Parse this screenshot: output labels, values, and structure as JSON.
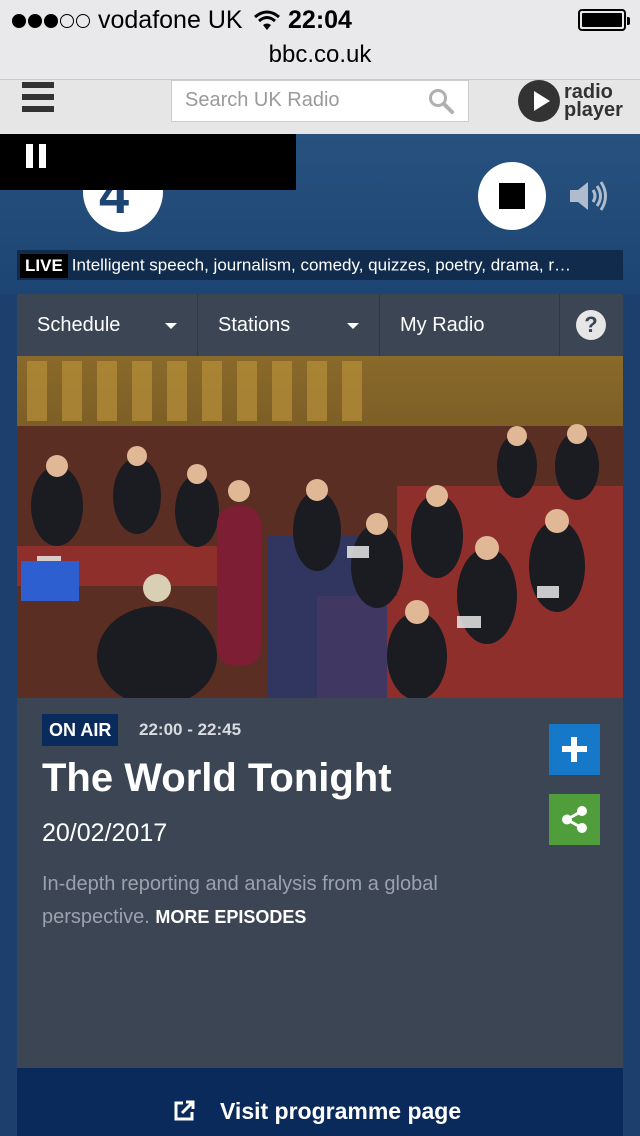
{
  "status_bar": {
    "carrier": "vodafone UK",
    "time": "22:04",
    "signal_bars_filled": 3,
    "signal_bars_total": 5
  },
  "url_bar": {
    "domain": "bbc.co.uk"
  },
  "header": {
    "search_placeholder": "Search UK Radio",
    "logo_line1": "radio",
    "logo_line2": "player"
  },
  "player": {
    "station_number": "4",
    "live_label": "LIVE",
    "live_description": "Intelligent speech, journalism, comedy, quizzes, poetry, drama, r…"
  },
  "nav": {
    "schedule": "Schedule",
    "stations": "Stations",
    "my_radio": "My Radio",
    "help": "?"
  },
  "programme": {
    "on_air_label": "ON AIR",
    "time_slot": "22:00 - 22:45",
    "title": "The World Tonight",
    "date": "20/02/2017",
    "description": "In-depth reporting and analysis from a global perspective.",
    "more_link": "MORE EPISODES"
  },
  "visit": {
    "label": "Visit programme page"
  },
  "colors": {
    "nav_bg": "#3c4554",
    "panel_bg": "#3c4554",
    "on_air_bg": "#0a2a5b",
    "add_button": "#1678c8",
    "share_button": "#4f9e3b",
    "player_bg": "#1d4573"
  }
}
